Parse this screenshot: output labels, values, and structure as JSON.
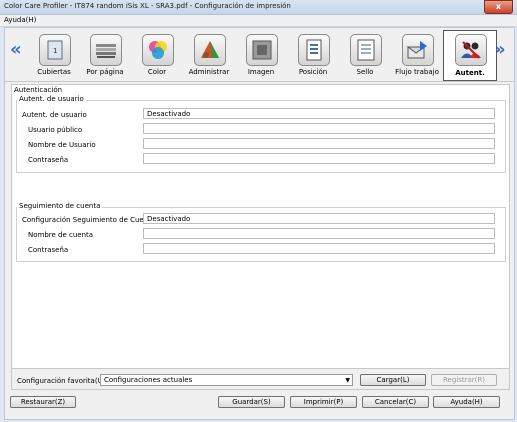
{
  "window": {
    "title": "Color Care Profiler - IT874 random iSis XL - SRA3.pdf - Configuración de impresión",
    "close_glyph": "x"
  },
  "menu": {
    "help": "Ayuda(H)"
  },
  "toolbar": {
    "prev_glyph": "«",
    "next_glyph": "»",
    "items": [
      {
        "label": "Cubiertas",
        "icon": "cover-icon"
      },
      {
        "label": "Por página",
        "icon": "per-page-icon"
      },
      {
        "label": "Color",
        "icon": "color-icon"
      },
      {
        "label": "Administrar",
        "icon": "manage-icon"
      },
      {
        "label": "Imagen",
        "icon": "image-icon"
      },
      {
        "label": "Posición",
        "icon": "position-icon"
      },
      {
        "label": "Sello",
        "icon": "stamp-icon"
      },
      {
        "label": "Flujo trabajo",
        "icon": "workflow-icon"
      },
      {
        "label": "Autent.",
        "icon": "authentication-icon",
        "active": true
      }
    ]
  },
  "auth": {
    "section_title": "Autenticación",
    "user_group": {
      "title": "Autent. de usuario",
      "user_auth_label": "Autent. de usuario",
      "user_auth_value": "Desactivado",
      "public_user_label": "Usuario público",
      "public_user_value": "",
      "username_label": "Nombre de Usuario",
      "username_value": "",
      "password_label": "Contraseña",
      "password_value": ""
    },
    "account_group": {
      "title": "Seguimiento de cuenta",
      "config_label": "Configuración Seguimiento de Cuenta",
      "config_value": "Desactivado",
      "account_name_label": "Nombre de cuenta",
      "account_name_value": "",
      "password_label": "Contraseña",
      "password_value": ""
    }
  },
  "favorites": {
    "label": "Configuración favorita(U)",
    "selected": "Configuraciones actuales",
    "load": "Cargar(L)",
    "register": "Registrar(R)"
  },
  "footer": {
    "restore": "Restaurar(Z)",
    "save": "Guardar(S)",
    "print": "Imprimir(P)",
    "cancel": "Cancelar(C)",
    "help": "Ayuda(H)"
  }
}
